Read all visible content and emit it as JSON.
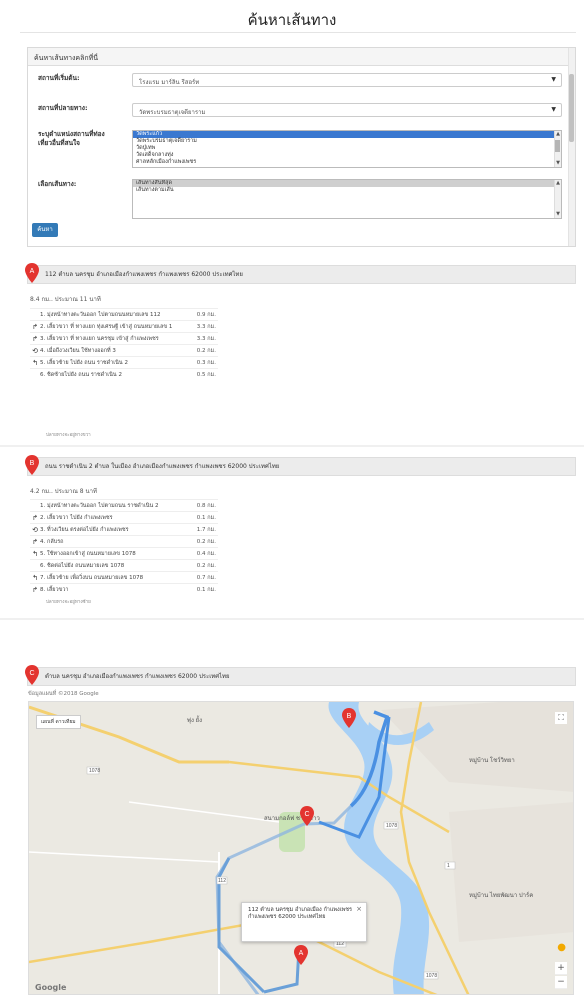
{
  "page": {
    "title": "ค้นหาเส้นทาง"
  },
  "form": {
    "header": "ค้นหาเส้นทางคลิกที่นี่",
    "start_label": "สถานที่เริ่มต้น:",
    "start_value": "โรงแรม มาร์ลิน รีสอร์ท",
    "end_label": "สถานที่ปลายทาง:",
    "end_value": "วัดพระบรมธาตุเจดียาราม",
    "waypoints_label_1": "ระบุตำแหน่งสถานที่ท่อง",
    "waypoints_label_2": "เที่ยวอื่นที่สนใจ",
    "waypoints": [
      "วัดพระแก้ว",
      "วัดพระบรมธาตุเจดียาราม",
      "วัดปู่เทพ",
      "วัดเสด็จกลางทุ่ง",
      "ศาลหลักเมืองกำแพงเพชร"
    ],
    "route_label": "เลือกเส้นทาง:",
    "routes": [
      "เส้นทางสั้นที่สุด",
      "เส้นทางตามเส้น"
    ],
    "search_label": "ค้นหา"
  },
  "route_a": {
    "address": "112 ตำบล นครชุม อำเภอเมืองกำแพงเพชร กำแพงเพชร 62000 ประเทศไทย",
    "summary": "8.4 กม.. ประมาณ 11 นาที",
    "steps": [
      {
        "icon": "",
        "text": "1. มุ่งหน้าทางตะวันออก ไปตามถนนหมายเลข 112",
        "dist": "0.9 กม."
      },
      {
        "icon": "↱",
        "text": "2. เลี้ยวขวา ที่ ทางแยก ทุ่งเศรษฐี เข้าสู่ ถนนหมายเลข 1",
        "dist": "3.3 กม."
      },
      {
        "icon": "↱",
        "text": "3. เลี้ยวขวา ที่ ทางแยก นครชุม เข้าสู่ กำแพงเพชร",
        "dist": "3.3 กม."
      },
      {
        "icon": "⟲",
        "text": "4. เมื่อถึงวงเวียน ใช้ทางออกที่ 3",
        "dist": "0.2 กม."
      },
      {
        "icon": "↰",
        "text": "5. เลี้ยวซ้าย ไปยัง ถนน ราชดำเนิน 2",
        "dist": "0.3 กม."
      },
      {
        "icon": "",
        "text": "6. ชิดซ้ายไปยัง ถนน ราชดำเนิน 2",
        "dist": "0.5 กม."
      }
    ],
    "note": "ปลายทางจะอยู่ทางขวา"
  },
  "route_b": {
    "address": "ถนน ราชดำเนิน 2 ตำบล ในเมือง อำเภอเมืองกำแพงเพชร กำแพงเพชร 62000 ประเทศไทย",
    "summary": "4.2 กม.. ประมาณ 8 นาที",
    "steps": [
      {
        "icon": "",
        "text": "1. มุ่งหน้าทางตะวันออก ไปตามถนน ราชดำเนิน 2",
        "dist": "0.8 กม."
      },
      {
        "icon": "↱",
        "text": "2. เลี้ยวขวา ไปยัง กำแพงเพชร",
        "dist": "0.1 กม."
      },
      {
        "icon": "⟲",
        "text": "3. ที่วงเวียน ตรงต่อไปยัง กำแพงเพชร",
        "dist": "1.7 กม."
      },
      {
        "icon": "↱",
        "text": "4. กลับรถ",
        "dist": "0.2 กม."
      },
      {
        "icon": "↰",
        "text": "5. ใช้ทางออกเข้าสู่ ถนนหมายเลข 1078",
        "dist": "0.4 กม."
      },
      {
        "icon": "",
        "text": "6. ชิดต่อไปยัง ถนนหมายเลข 1078",
        "dist": "0.2 กม."
      },
      {
        "icon": "↰",
        "text": "7. เลี้ยวซ้าย เพื่อวิ่งบน ถนนหมายเลข 1078",
        "dist": "0.7 กม."
      },
      {
        "icon": "↱",
        "text": "8. เลี้ยวขวา",
        "dist": "0.1 กม."
      }
    ],
    "note": "ปลายทางจะอยู่ทางซ้าย"
  },
  "route_c": {
    "address": "ตำบล นครชุม อำเภอเมืองกำแพงเพชร กำแพงเพชร 62000 ประเทศไทย"
  },
  "map": {
    "credit": "ข้อมูลแผนที่ ©2018 Google",
    "type_buttons": "แผนที่ ดาวเทียม",
    "info_text": "112 ตำบล นครชุม อำเภอเมือง กำแพงเพชร กำแพงเพชร 62000 ประเทศไทย",
    "labels": {
      "village_1": "หมู่บ้าน โชว์วิทยา",
      "village_2": "หมู่บ้าน ไทยพัฒนา ปาร์ค",
      "park": "สนามกอล์ฟ ชากังราว",
      "place_top": "พุ่ง ยั้ง"
    },
    "road_numbers": [
      "1078",
      "1",
      "112",
      "1078",
      "1",
      "1078",
      "112"
    ],
    "logo": "Google",
    "zoom_in": "+",
    "zoom_out": "−",
    "fullscreen": "⛶"
  },
  "markers": {
    "a": "A",
    "b": "B",
    "c": "C"
  },
  "colors": {
    "accent": "#337ab7",
    "marker": "#e3342f",
    "route": "#4a90e2",
    "river": "#a8d0f5"
  }
}
